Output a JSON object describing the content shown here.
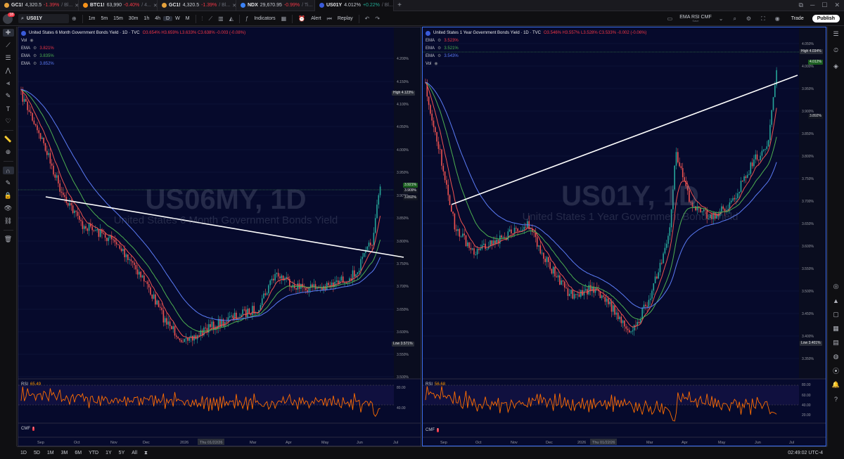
{
  "tabs": [
    {
      "symbol": "GC1!",
      "price": "4,320.5",
      "change": "-1.39%",
      "rest": "/ Bl...",
      "dot": "#e6a23c",
      "dir": "neg"
    },
    {
      "symbol": "BTC1!",
      "price": "63,990",
      "change": "-0.40%",
      "rest": "/ 4...",
      "dot": "#f7931a",
      "dir": "neg"
    },
    {
      "symbol": "GC1!",
      "price": "4,320.5",
      "change": "-1.39%",
      "rest": "/ Bl...",
      "dot": "#e6a23c",
      "dir": "neg"
    },
    {
      "symbol": "NDX",
      "price": "29,670.95",
      "change": "-0.99%",
      "rest": "/ Ti...",
      "dot": "#3b82f6",
      "dir": "neg"
    },
    {
      "symbol": "US01Y",
      "price": "4.012%",
      "change": "+0.22%",
      "rest": "/ Bl...",
      "dot": "#3a5bd9",
      "dir": "pos"
    }
  ],
  "toolbar": {
    "symbol": "US01Y",
    "intervals": [
      "1m",
      "5m",
      "15m",
      "30m",
      "1h",
      "4h",
      "D",
      "W",
      "M"
    ],
    "active_interval": "D",
    "indicators_label": "Indicators",
    "alert_label": "Alert",
    "replay_label": "Replay",
    "layout_name": "EMA RSI CMF",
    "layout_sub": "Save",
    "trade_label": "Trade",
    "publish_label": "Publish",
    "notification_count": "18"
  },
  "left_chart": {
    "title": "United States 6 Month Government Bonds Yield · 1D · TVC",
    "ohlc": "O3.654% H3.659% L3.633% C3.638% -0.003 (-0.08%)",
    "vol_label": "Vol",
    "emas": [
      {
        "label": "EMA",
        "value": "3.821%",
        "color": "#f23645"
      },
      {
        "label": "EMA",
        "value": "3.835%",
        "color": "#4caf50"
      },
      {
        "label": "EMA",
        "value": "3.852%",
        "color": "#5b7cf7"
      }
    ],
    "watermark_symbol": "US06MY, 1D",
    "watermark_name": "United States 6 Month Government Bonds Yield",
    "price_axis": [
      "4.200%",
      "4.150%",
      "4.100%",
      "4.050%",
      "4.000%",
      "3.950%",
      "3.900%",
      "3.850%",
      "3.800%",
      "3.750%",
      "3.700%",
      "3.650%",
      "3.600%",
      "3.550%",
      "3.500%"
    ],
    "high_label": "High",
    "high_value": "4.123%",
    "low_label": "Low",
    "low_value": "3.571%",
    "last_values": [
      "3.921%",
      "3.909%",
      "3.892%"
    ],
    "rsi_label": "RSI",
    "rsi_value": "65.49",
    "rsi_axis": [
      "80.00",
      "40.00"
    ],
    "cmf_label": "CMF",
    "time_axis": [
      "Sep",
      "Oct",
      "Nov",
      "Dec",
      "2026",
      "Thu 01/22/26",
      "Mar",
      "Apr",
      "May",
      "Jun",
      "Jul"
    ]
  },
  "right_chart": {
    "title": "United States 1 Year Government Bonds Yield · 1D · TVC",
    "ohlc": "O3.546% H3.557% L3.528% C3.533% -0.002 (-0.06%)",
    "vol_label": "Vol",
    "emas": [
      {
        "label": "EMA",
        "value": "3.523%",
        "color": "#f23645"
      },
      {
        "label": "EMA",
        "value": "3.521%",
        "color": "#4caf50"
      },
      {
        "label": "EMA",
        "value": "3.543%",
        "color": "#5b7cf7"
      }
    ],
    "watermark_symbol": "US01Y, 1D",
    "watermark_name": "United States 1 Year Government Bonds Yield",
    "price_axis": [
      "4.050%",
      "4.000%",
      "3.950%",
      "3.900%",
      "3.850%",
      "3.800%",
      "3.750%",
      "3.700%",
      "3.650%",
      "3.600%",
      "3.550%",
      "3.500%",
      "3.450%",
      "3.400%",
      "3.350%"
    ],
    "high_label": "High",
    "high_value": "4.034%",
    "low_label": "Low",
    "low_value": "3.401%",
    "last_values": [
      "4.012%",
      "3.892%"
    ],
    "rsi_label": "RSI",
    "rsi_value": "56.68",
    "rsi_axis": [
      "80.00",
      "60.00",
      "40.00",
      "20.00"
    ],
    "cmf_label": "CMF",
    "time_axis": [
      "Sep",
      "Oct",
      "Nov",
      "Dec",
      "2026",
      "Thu 01/22/26",
      "Mar",
      "Apr",
      "May",
      "Jun",
      "Jul"
    ]
  },
  "bottom": {
    "ranges": [
      "1D",
      "5D",
      "1M",
      "3M",
      "6M",
      "YTD",
      "1Y",
      "5Y",
      "All"
    ],
    "clock": "02:49:02 UTC-4"
  }
}
